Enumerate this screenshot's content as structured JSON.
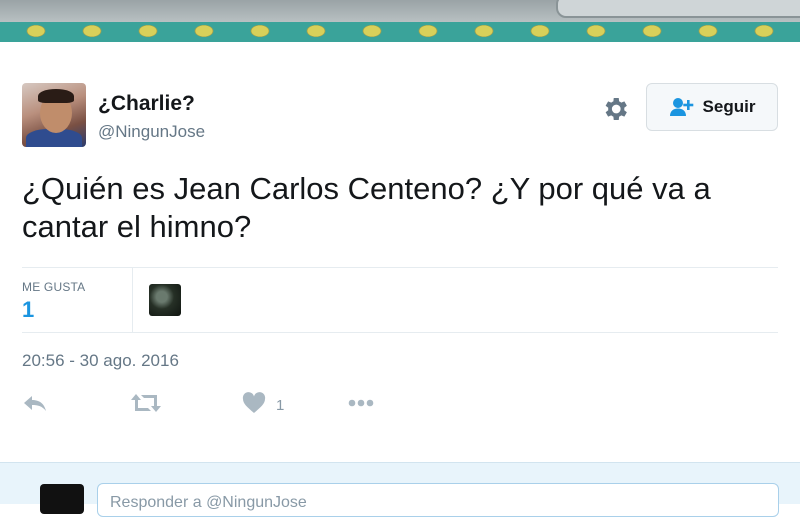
{
  "tweet": {
    "author_name": "¿Charlie?",
    "author_handle": "@NingunJose",
    "follow_label": "Seguir",
    "text": "¿Quién es Jean Carlos Centeno? ¿Y por qué va a cantar el himno?",
    "likes_label": "ME GUSTA",
    "likes_count": "1",
    "timestamp": "20:56 - 30 ago. 2016",
    "heart_action_count": "1"
  },
  "reply_box": {
    "placeholder": "Responder a @NingunJose"
  },
  "icons": {
    "settings": "gear-icon",
    "follow": "add-user-icon",
    "reply": "reply-icon",
    "retweet": "retweet-icon",
    "like": "heart-icon",
    "more": "more-dots-icon"
  },
  "colors": {
    "link_blue": "#1b95e0",
    "muted_gray": "#657786",
    "icon_gray": "#aab8c2"
  }
}
